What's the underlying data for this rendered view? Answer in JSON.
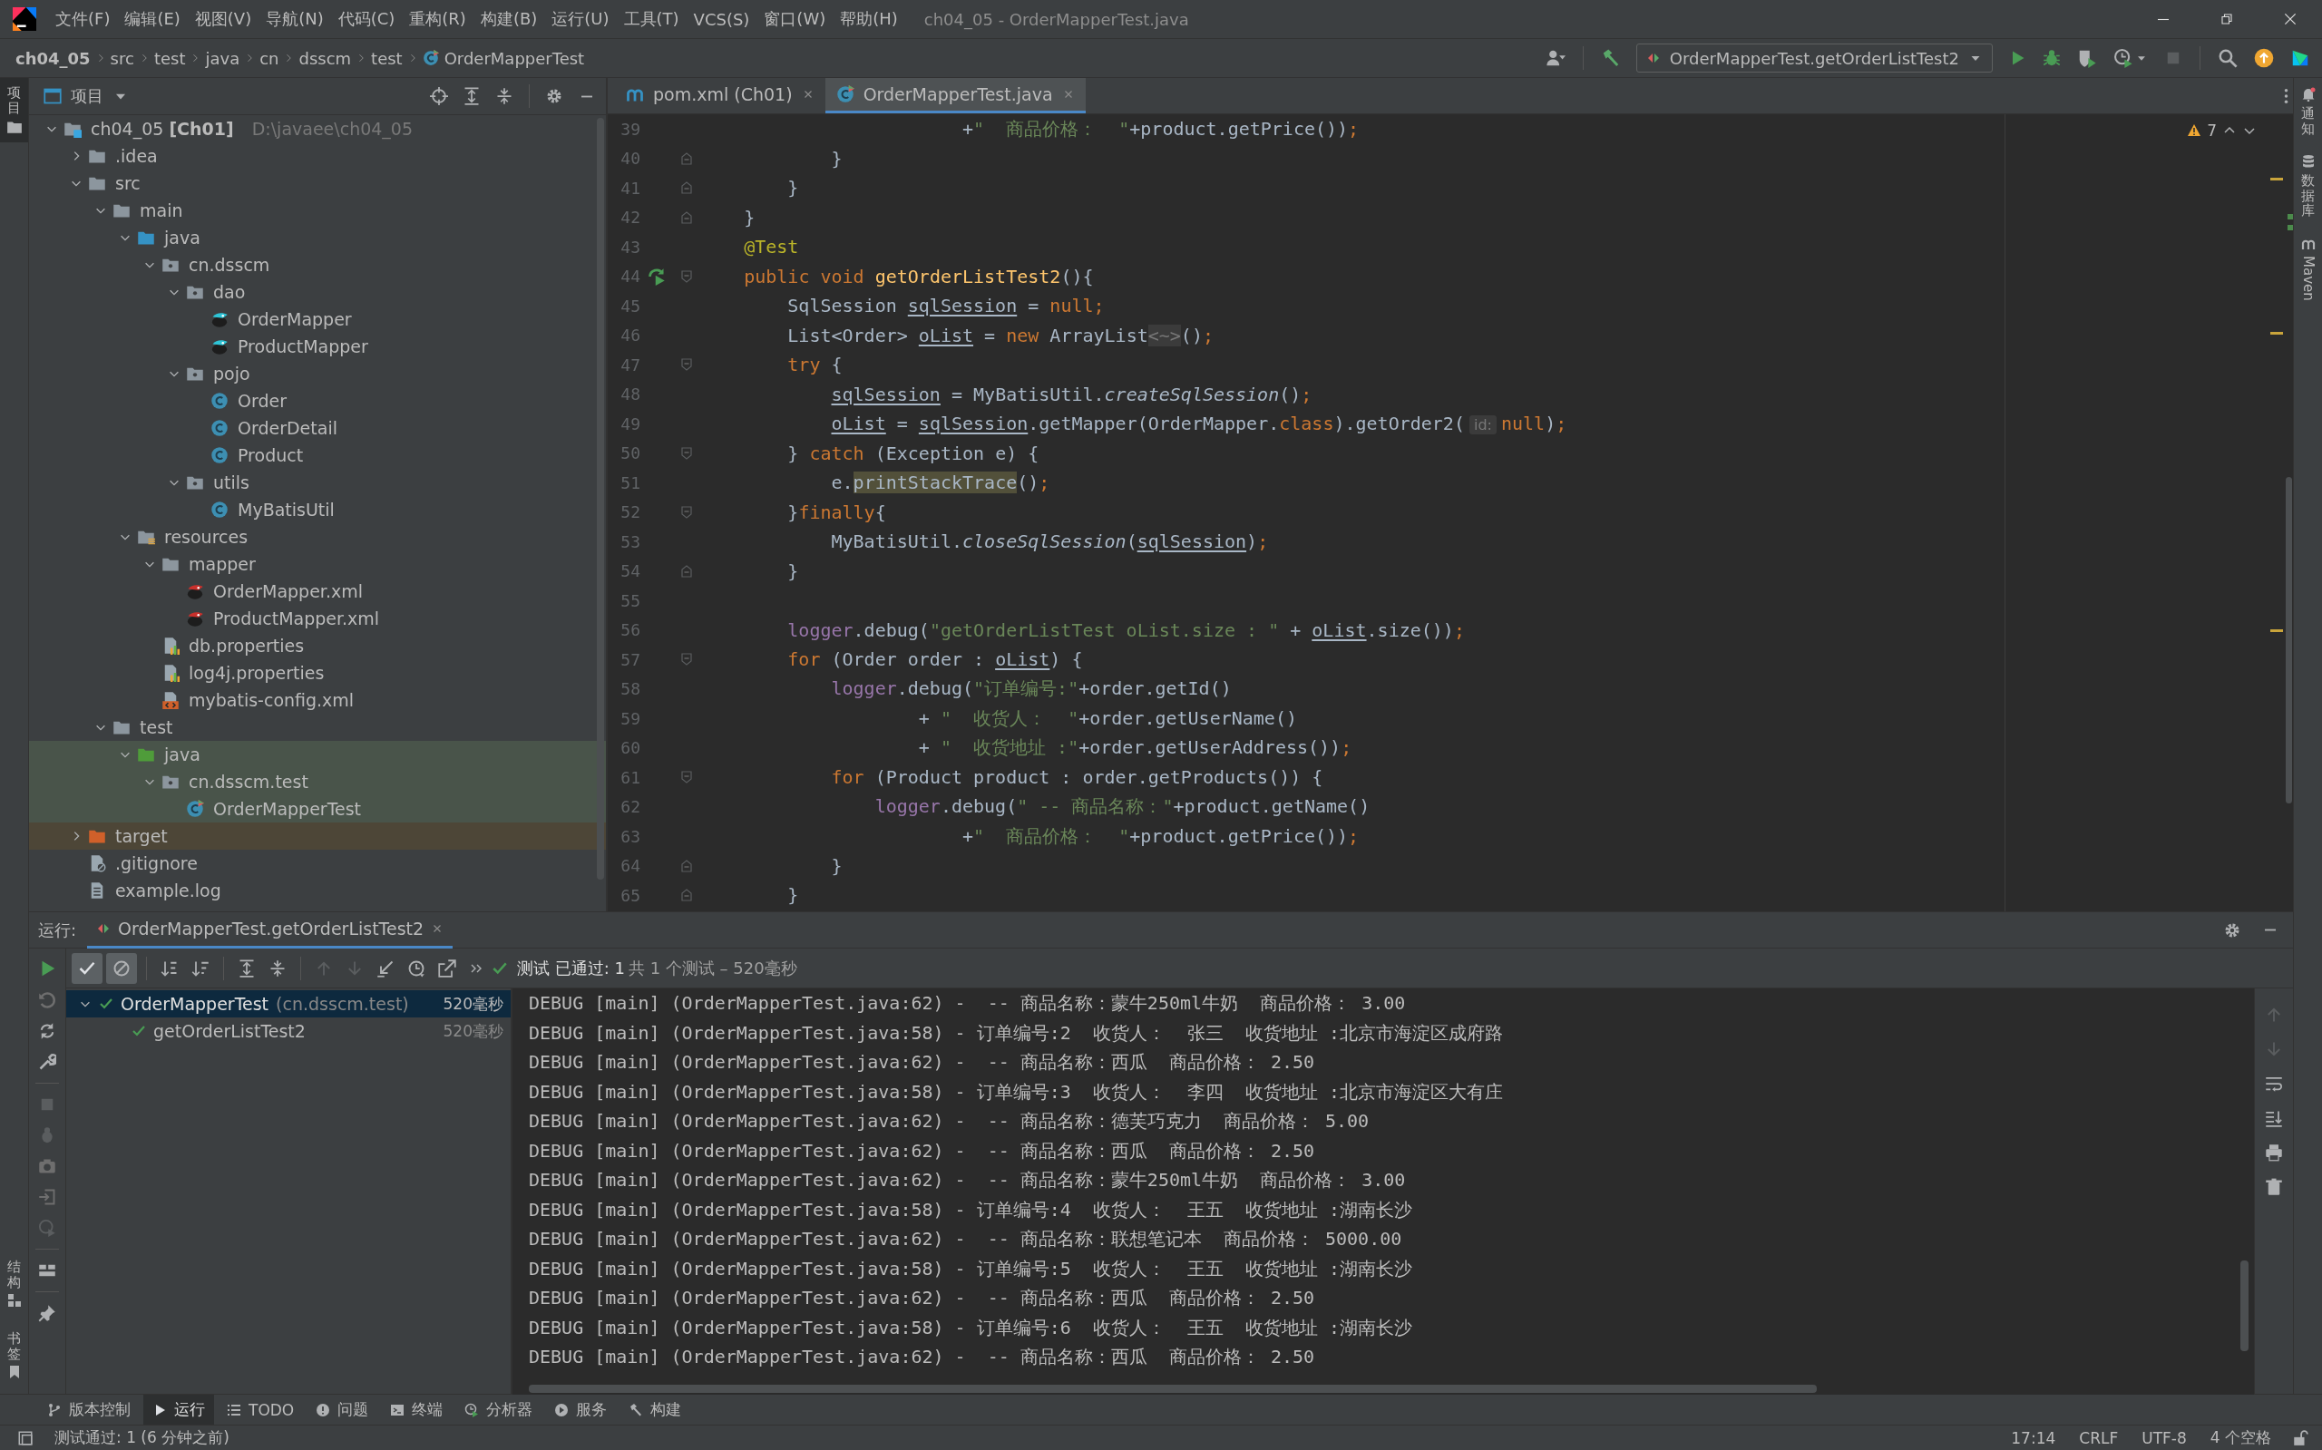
{
  "window": {
    "title": "ch04_05 - OrderMapperTest.java"
  },
  "menu": [
    "文件(F)",
    "编辑(E)",
    "视图(V)",
    "导航(N)",
    "代码(C)",
    "重构(R)",
    "构建(B)",
    "运行(U)",
    "工具(T)",
    "VCS(S)",
    "窗口(W)",
    "帮助(H)"
  ],
  "breadcrumbs": [
    "ch04_05",
    "src",
    "test",
    "java",
    "cn",
    "dsscm",
    "test",
    "OrderMapperTest"
  ],
  "run_configuration": "OrderMapperTest.getOrderListTest2",
  "left_strip": {
    "top": [
      {
        "label": "项目",
        "selected": true
      }
    ],
    "bottom": [
      {
        "label": "结构",
        "selected": false
      },
      {
        "label": "书签",
        "selected": false
      }
    ]
  },
  "right_strip": [
    {
      "label": "通知",
      "kind": "stacked"
    },
    {
      "label": "数据库",
      "kind": "stacked"
    },
    {
      "label": "Maven",
      "kind": "rotated"
    }
  ],
  "project": {
    "title": "项目",
    "tree": [
      {
        "label": "ch04_05 **[Ch01]**",
        "path": "D:\\javaee\\ch04_05",
        "kind": "module",
        "expanded": true,
        "children": [
          {
            "label": ".idea",
            "kind": "folder",
            "expanded": false
          },
          {
            "label": "src",
            "kind": "folder",
            "expanded": true,
            "children": [
              {
                "label": "main",
                "kind": "folder",
                "expanded": true,
                "children": [
                  {
                    "label": "java",
                    "kind": "source-folder",
                    "expanded": true,
                    "children": [
                      {
                        "label": "cn.dsscm",
                        "kind": "package",
                        "expanded": true,
                        "children": [
                          {
                            "label": "dao",
                            "kind": "package",
                            "expanded": true,
                            "children": [
                              {
                                "label": "OrderMapper",
                                "kind": "mapper"
                              },
                              {
                                "label": "ProductMapper",
                                "kind": "mapper"
                              }
                            ]
                          },
                          {
                            "label": "pojo",
                            "kind": "package",
                            "expanded": true,
                            "children": [
                              {
                                "label": "Order",
                                "kind": "class"
                              },
                              {
                                "label": "OrderDetail",
                                "kind": "class"
                              },
                              {
                                "label": "Product",
                                "kind": "class"
                              }
                            ]
                          },
                          {
                            "label": "utils",
                            "kind": "package",
                            "expanded": true,
                            "children": [
                              {
                                "label": "MyBatisUtil",
                                "kind": "class"
                              }
                            ]
                          }
                        ]
                      }
                    ]
                  },
                  {
                    "label": "resources",
                    "kind": "resources-folder",
                    "expanded": true,
                    "children": [
                      {
                        "label": "mapper",
                        "kind": "folder",
                        "expanded": true,
                        "children": [
                          {
                            "label": "OrderMapper.xml",
                            "kind": "mapper-xml"
                          },
                          {
                            "label": "ProductMapper.xml",
                            "kind": "mapper-xml"
                          }
                        ]
                      },
                      {
                        "label": "db.properties",
                        "kind": "properties"
                      },
                      {
                        "label": "log4j.properties",
                        "kind": "properties"
                      },
                      {
                        "label": "mybatis-config.xml",
                        "kind": "config-xml"
                      }
                    ]
                  }
                ]
              },
              {
                "label": "test",
                "kind": "folder",
                "expanded": true,
                "children": [
                  {
                    "label": "java",
                    "kind": "test-folder",
                    "expanded": true,
                    "children": [
                      {
                        "label": "cn.dsscm.test",
                        "kind": "test-package",
                        "expanded": true,
                        "children": [
                          {
                            "label": "OrderMapperTest",
                            "kind": "test-class"
                          }
                        ]
                      }
                    ]
                  }
                ]
              }
            ]
          },
          {
            "label": "target",
            "kind": "excluded-folder",
            "expanded": false
          },
          {
            "label": ".gitignore",
            "kind": "ignore-file"
          },
          {
            "label": "example.log",
            "kind": "log-file"
          }
        ]
      }
    ]
  },
  "editor": {
    "tabs": [
      {
        "label": "pom.xml (Ch01)",
        "kind": "pom",
        "selected": false
      },
      {
        "label": "OrderMapperTest.java",
        "kind": "test-class",
        "selected": true
      }
    ],
    "warning_count": "7",
    "lines": [
      {
        "number": "39",
        "tokens": [
          "                        +",
          {
            "text": "\"  商品价格：  \"",
            "kind": "string"
          },
          "+product.getPrice())",
          {
            "text": ";",
            "kind": "keyword"
          }
        ]
      },
      {
        "number": "40",
        "fold_end": true,
        "tokens": [
          "            }"
        ]
      },
      {
        "number": "41",
        "fold_end": true,
        "tokens": [
          "        }"
        ]
      },
      {
        "number": "42",
        "fold_end": true,
        "tokens": [
          "    }"
        ]
      },
      {
        "number": "43",
        "tokens": [
          {
            "text": "    @Test",
            "kind": "annotation"
          }
        ]
      },
      {
        "number": "44",
        "fold_start": true,
        "run": true,
        "tokens": [
          {
            "text": "    public void ",
            "kind": "keyword"
          },
          {
            "text": "getOrderListTest2",
            "kind": "declaration"
          },
          "(){"
        ]
      },
      {
        "number": "45",
        "tokens": [
          "        SqlSession ",
          {
            "text": "sqlSession",
            "kind": "reassigned"
          },
          " = ",
          {
            "text": "null",
            "kind": "keyword"
          },
          {
            "text": ";",
            "kind": "keyword"
          }
        ]
      },
      {
        "number": "46",
        "tokens": [
          "        List<Order> ",
          {
            "text": "oList",
            "kind": "reassigned"
          },
          " = ",
          {
            "text": "new ",
            "kind": "keyword"
          },
          "ArrayList",
          {
            "text": "<~>",
            "kind": "folded"
          },
          "()",
          {
            "text": ";",
            "kind": "keyword"
          }
        ]
      },
      {
        "number": "47",
        "fold_start": true,
        "tokens": [
          {
            "text": "        try",
            "kind": "keyword"
          },
          " {"
        ]
      },
      {
        "number": "48",
        "tokens": [
          {
            "text": "            sqlSession",
            "kind": "reassigned"
          },
          " = MyBatisUtil.",
          {
            "text": "createSqlSession",
            "kind": "static"
          },
          "()",
          {
            "text": ";",
            "kind": "keyword"
          }
        ]
      },
      {
        "number": "49",
        "tokens": [
          {
            "text": "            oList",
            "kind": "reassigned"
          },
          " = ",
          {
            "text": "sqlSession",
            "kind": "reassigned"
          },
          ".getMapper(OrderMapper.",
          {
            "text": "class",
            "kind": "keyword"
          },
          ").getOrder2(",
          {
            "text": "id:",
            "kind": "hint"
          },
          {
            "text": "null",
            "kind": "keyword"
          },
          ")",
          {
            "text": ";",
            "kind": "keyword"
          }
        ]
      },
      {
        "number": "50",
        "fold_start": true,
        "tokens": [
          "        } ",
          {
            "text": "catch",
            "kind": "keyword"
          },
          " (Exception e) {"
        ]
      },
      {
        "number": "51",
        "tokens": [
          "            e.",
          {
            "text": "printStackTrace",
            "kind": "highlighted"
          },
          "()",
          {
            "text": ";",
            "kind": "keyword"
          }
        ]
      },
      {
        "number": "52",
        "fold_start": true,
        "tokens": [
          "        }",
          {
            "text": "finally",
            "kind": "keyword"
          },
          "{"
        ]
      },
      {
        "number": "53",
        "tokens": [
          "            MyBatisUtil.",
          {
            "text": "closeSqlSession",
            "kind": "static"
          },
          "(",
          {
            "text": "sqlSession",
            "kind": "reassigned"
          },
          ")",
          {
            "text": ";",
            "kind": "keyword"
          }
        ]
      },
      {
        "number": "54",
        "fold_end": true,
        "tokens": [
          "        }"
        ]
      },
      {
        "number": "55"
      },
      {
        "number": "56",
        "tokens": [
          {
            "text": "        logger",
            "kind": "field"
          },
          ".debug(",
          {
            "text": "\"getOrderListTest oList.size : \"",
            "kind": "string"
          },
          " + ",
          {
            "text": "oList",
            "kind": "reassigned"
          },
          ".size())",
          {
            "text": ";",
            "kind": "keyword"
          }
        ]
      },
      {
        "number": "57",
        "fold_start": true,
        "tokens": [
          {
            "text": "        for",
            "kind": "keyword"
          },
          " (Order order : ",
          {
            "text": "oList",
            "kind": "reassigned"
          },
          ") {"
        ]
      },
      {
        "number": "58",
        "tokens": [
          {
            "text": "            logger",
            "kind": "field"
          },
          ".debug(",
          {
            "text": "\"订单编号:\"",
            "kind": "string"
          },
          "+order.getId()"
        ]
      },
      {
        "number": "59",
        "tokens": [
          "                    + ",
          {
            "text": "\"  收货人：  \"",
            "kind": "string"
          },
          "+order.getUserName()"
        ]
      },
      {
        "number": "60",
        "tokens": [
          "                    + ",
          {
            "text": "\"  收货地址 :\"",
            "kind": "string"
          },
          "+order.getUserAddress())",
          {
            "text": ";",
            "kind": "keyword"
          }
        ]
      },
      {
        "number": "61",
        "fold_start": true,
        "tokens": [
          {
            "text": "            for",
            "kind": "keyword"
          },
          " (Product product : order.getProducts()) {"
        ]
      },
      {
        "number": "62",
        "tokens": [
          {
            "text": "                logger",
            "kind": "field"
          },
          ".debug(",
          {
            "text": "\" -- 商品名称：\"",
            "kind": "string"
          },
          "+product.getName()"
        ]
      },
      {
        "number": "63",
        "tokens": [
          "                        +",
          {
            "text": "\"  商品价格：  \"",
            "kind": "string"
          },
          "+product.getPrice())",
          {
            "text": ";",
            "kind": "keyword"
          }
        ]
      },
      {
        "number": "64",
        "fold_end": true,
        "tokens": [
          "            }"
        ]
      },
      {
        "number": "65",
        "fold_end": true,
        "tokens": [
          "        }"
        ]
      }
    ]
  },
  "run": {
    "title": "运行:",
    "tab": "OrderMapperTest.getOrderListTest2",
    "toggles": [
      {
        "selected": true
      },
      {
        "selected": true
      }
    ],
    "summary_status": "测试 已通过: 1",
    "summary_detail": "共 1 个测试 – 520毫秒",
    "tests": [
      {
        "name": "OrderMapperTest",
        "package": "(cn.dsscm.test)",
        "time": "520毫秒",
        "passed": true,
        "selected": true,
        "expanded": true,
        "children": [
          {
            "name": "getOrderListTest2",
            "time": "520毫秒",
            "passed": true,
            "selected": false
          }
        ]
      }
    ],
    "console": [
      "DEBUG [main] (OrderMapperTest.java:62) -  -- 商品名称：蒙牛250ml牛奶  商品价格： 3.00",
      "DEBUG [main] (OrderMapperTest.java:58) - 订单编号:2  收货人：  张三  收货地址 :北京市海淀区成府路",
      "DEBUG [main] (OrderMapperTest.java:62) -  -- 商品名称：西瓜  商品价格： 2.50",
      "DEBUG [main] (OrderMapperTest.java:58) - 订单编号:3  收货人：  李四  收货地址 :北京市海淀区大有庄",
      "DEBUG [main] (OrderMapperTest.java:62) -  -- 商品名称：德芙巧克力  商品价格： 5.00",
      "DEBUG [main] (OrderMapperTest.java:62) -  -- 商品名称：西瓜  商品价格： 2.50",
      "DEBUG [main] (OrderMapperTest.java:62) -  -- 商品名称：蒙牛250ml牛奶  商品价格： 3.00",
      "DEBUG [main] (OrderMapperTest.java:58) - 订单编号:4  收货人：  王五  收货地址 :湖南长沙",
      "DEBUG [main] (OrderMapperTest.java:62) -  -- 商品名称：联想笔记本  商品价格： 5000.00",
      "DEBUG [main] (OrderMapperTest.java:58) - 订单编号:5  收货人：  王五  收货地址 :湖南长沙",
      "DEBUG [main] (OrderMapperTest.java:62) -  -- 商品名称：西瓜  商品价格： 2.50",
      "DEBUG [main] (OrderMapperTest.java:58) - 订单编号:6  收货人：  王五  收货地址 :湖南长沙",
      "DEBUG [main] (OrderMapperTest.java:62) -  -- 商品名称：西瓜  商品价格： 2.50"
    ]
  },
  "tool_windows": [
    {
      "label": "版本控制",
      "kind": "vcs",
      "selected": false
    },
    {
      "label": "运行",
      "kind": "run",
      "selected": true
    },
    {
      "label": "TODO",
      "kind": "todo",
      "selected": false
    },
    {
      "label": "问题",
      "kind": "problems",
      "selected": false
    },
    {
      "label": "终端",
      "kind": "terminal",
      "selected": false
    },
    {
      "label": "分析器",
      "kind": "profiler",
      "selected": false
    },
    {
      "label": "服务",
      "kind": "services",
      "selected": false
    },
    {
      "label": "构建",
      "kind": "build",
      "selected": false
    }
  ],
  "status_bar": {
    "message": "测试通过: 1 (6 分钟之前)",
    "items": [
      "17:14",
      "CRLF",
      "UTF-8",
      "4 个空格"
    ]
  }
}
